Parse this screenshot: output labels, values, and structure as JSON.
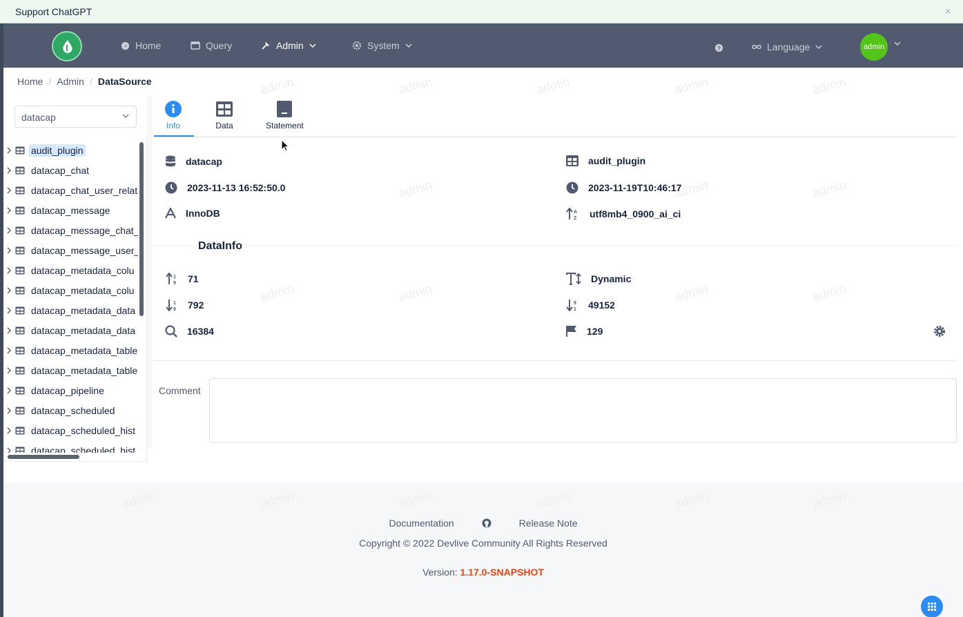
{
  "banner": {
    "text": "Support ChatGPT",
    "close": "×"
  },
  "nav": {
    "items": [
      {
        "label": "Home",
        "icon": "home-icon"
      },
      {
        "label": "Query",
        "icon": "query-icon"
      },
      {
        "label": "Admin",
        "icon": "hammer-icon"
      },
      {
        "label": "System",
        "icon": "gear-icon"
      }
    ],
    "language": "Language",
    "user": "admin"
  },
  "breadcrumb": [
    "Home",
    "Admin",
    "DataSource"
  ],
  "database_select": {
    "value": "datacap"
  },
  "tree": {
    "items": [
      "audit_plugin",
      "datacap_chat",
      "datacap_chat_user_relat",
      "datacap_message",
      "datacap_message_chat_",
      "datacap_message_user_",
      "datacap_metadata_colu",
      "datacap_metadata_colu",
      "datacap_metadata_data",
      "datacap_metadata_data",
      "datacap_metadata_table",
      "datacap_metadata_table",
      "datacap_pipeline",
      "datacap_scheduled",
      "datacap_scheduled_hist",
      "datacap_scheduled_hist"
    ],
    "selected_index": 0
  },
  "tabs": [
    {
      "label": "Info",
      "icon": "info-icon"
    },
    {
      "label": "Data",
      "icon": "table-icon"
    },
    {
      "label": "Statement",
      "icon": "terminal-icon"
    }
  ],
  "info": {
    "database": "datacap",
    "table": "audit_plugin",
    "create_time": "2023-11-13 16:52:50.0",
    "update_time": "2023-11-19T10:46:17",
    "engine": "InnoDB",
    "collation": "utf8mb4_0900_ai_ci"
  },
  "data_info": {
    "title": "DataInfo",
    "avg_row_length": "71",
    "row_format": "Dynamic",
    "rows": "792",
    "data_length": "49152",
    "index_length": "16384",
    "auto_increment": "129"
  },
  "comment": {
    "label": "Comment",
    "value": ""
  },
  "footer": {
    "documentation": "Documentation",
    "release_note": "Release Note",
    "copyright": "Copyright © 2022 Devlive Community All Rights Reserved",
    "version_label": "Version:",
    "version": "1.17.0-SNAPSHOT"
  },
  "watermark": "admin",
  "colors": {
    "nav_bg": "#515a6e",
    "accent": "#2d8cf0",
    "version": "#ed4014",
    "avatar": "#52c41a"
  }
}
